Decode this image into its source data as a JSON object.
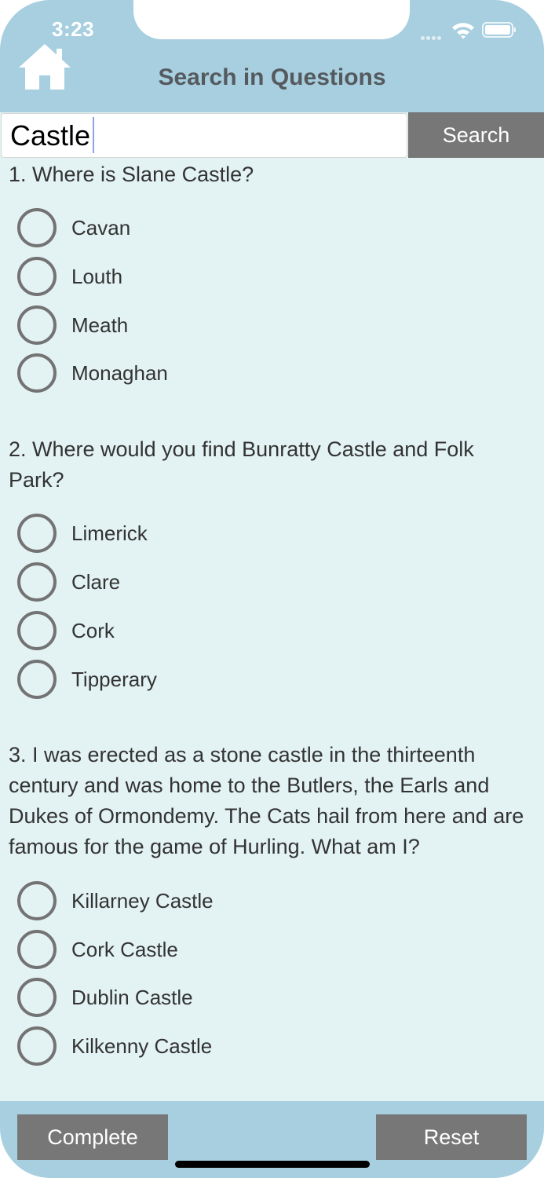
{
  "status_bar": {
    "time": "3:23"
  },
  "header": {
    "title": "Search in Questions"
  },
  "search": {
    "value": "Castle",
    "button_label": "Search"
  },
  "questions": [
    {
      "text": "1. Where is Slane Castle?",
      "options": [
        "Cavan",
        "Louth",
        "Meath",
        "Monaghan"
      ]
    },
    {
      "text": "2. Where would you find Bunratty Castle and Folk Park?",
      "options": [
        "Limerick",
        "Clare",
        "Cork",
        "Tipperary"
      ]
    },
    {
      "text": "3. I was erected as a stone castle in the thirteenth century and was home to the Butlers, the Earls and Dukes of Ormondemy. The Cats hail from here and are famous for the game of Hurling. What am I?",
      "options": [
        "Killarney Castle",
        "Cork Castle",
        "Dublin Castle",
        "Kilkenny Castle"
      ]
    }
  ],
  "footer": {
    "complete_label": "Complete",
    "reset_label": "Reset"
  },
  "colors": {
    "header_bg": "#a7cfe0",
    "content_bg": "#e3f2f3",
    "button_bg": "#777777"
  }
}
